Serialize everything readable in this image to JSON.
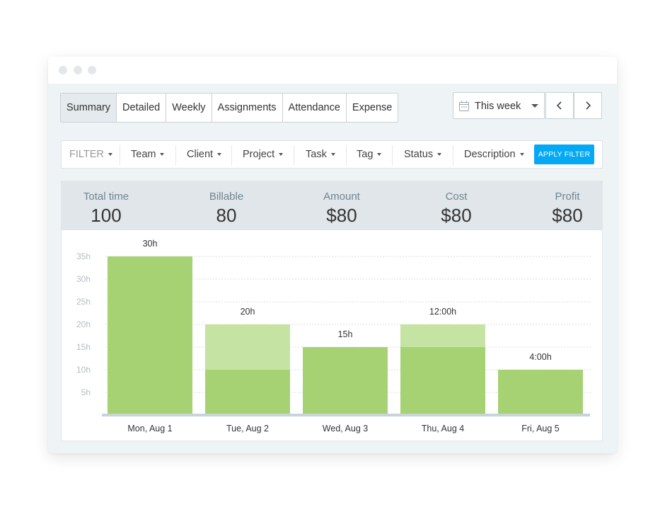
{
  "window": {
    "controls": [
      "close",
      "minimize",
      "maximize"
    ]
  },
  "tabs": [
    {
      "label": "Summary",
      "active": true
    },
    {
      "label": "Detailed",
      "active": false
    },
    {
      "label": "Weekly",
      "active": false
    },
    {
      "label": "Assignments",
      "active": false
    },
    {
      "label": "Attendance",
      "active": false
    },
    {
      "label": "Expense",
      "active": false
    }
  ],
  "date_range": {
    "label": "This week",
    "icon": "calendar-icon"
  },
  "navigation": {
    "prev_icon": "chevron-left-icon",
    "next_icon": "chevron-right-icon"
  },
  "filters": {
    "items": [
      "FILTER",
      "Team",
      "Client",
      "Project",
      "Task",
      "Tag",
      "Status",
      "Description"
    ],
    "apply_label": "APPLY FILTER"
  },
  "summary": [
    {
      "label": "Total time",
      "value": "100"
    },
    {
      "label": "Billable",
      "value": "80"
    },
    {
      "label": "Amount",
      "value": "$80"
    },
    {
      "label": "Cost",
      "value": "$80"
    },
    {
      "label": "Profit",
      "value": "$80"
    }
  ],
  "colors": {
    "accent": "#03a9f4",
    "bar_billable": "#a6d273",
    "bar_non_billable": "#c5e3a3",
    "baseline": "#c8d3dc",
    "grid": "#d9dde0"
  },
  "chart_data": {
    "type": "bar",
    "stacked": true,
    "categories": [
      "Mon, Aug 1",
      "Tue, Aug 2",
      "Wed, Aug 3",
      "Thu, Aug 4",
      "Fri, Aug 5"
    ],
    "series": [
      {
        "values": [
          35,
          10,
          15,
          15,
          10
        ]
      },
      {
        "values": [
          0,
          10,
          0,
          5,
          0
        ]
      }
    ],
    "bar_labels": [
      "30h",
      "20h",
      "15h",
      "12:00h",
      "4:00h"
    ],
    "yticks": [
      "5h",
      "10h",
      "15h",
      "20h",
      "25h",
      "30h",
      "35h"
    ],
    "ylim": [
      0,
      35
    ],
    "grid": true
  }
}
